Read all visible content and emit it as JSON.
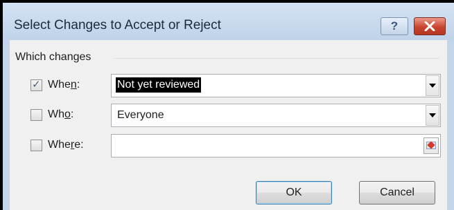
{
  "dialog": {
    "title": "Select Changes to Accept or Reject",
    "help_glyph": "?",
    "close_glyph": "✕"
  },
  "group": {
    "caption": "Which changes"
  },
  "rows": [
    {
      "label_pre": "Whe",
      "label_key": "n",
      "label_post": ":",
      "checked": true,
      "value": "Not yet reviewed",
      "control": "dropdown"
    },
    {
      "label_pre": "Wh",
      "label_key": "o",
      "label_post": ":",
      "checked": false,
      "value": "Everyone",
      "control": "dropdown"
    },
    {
      "label_pre": "Whe",
      "label_key": "r",
      "label_post": "e:",
      "checked": false,
      "value": "",
      "control": "range"
    }
  ],
  "check_glyph": "✓",
  "buttons": {
    "ok": "OK",
    "cancel": "Cancel"
  },
  "colors": {
    "frame": "#c3d5ea",
    "close": "#c9442e",
    "selection": "#000000"
  }
}
